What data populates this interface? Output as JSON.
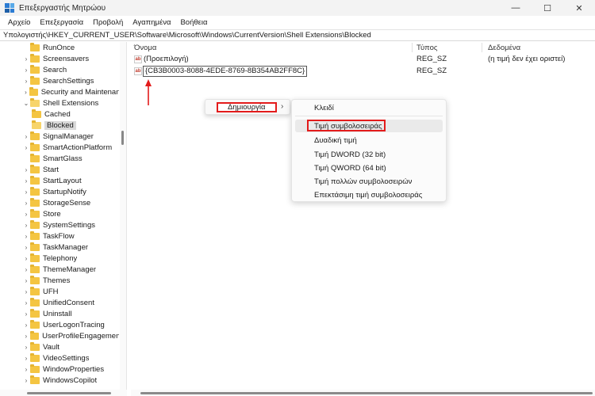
{
  "window": {
    "title": "Επεξεργαστής Μητρώου",
    "minimize": "—",
    "maximize": "☐",
    "close": "✕"
  },
  "menu": [
    "Αρχείο",
    "Επεξεργασία",
    "Προβολή",
    "Αγαπημένα",
    "Βοήθεια"
  ],
  "address": "Υπολογιστής\\HKEY_CURRENT_USER\\Software\\Microsoft\\Windows\\CurrentVersion\\Shell Extensions\\Blocked",
  "tree": [
    {
      "label": "RunOnce",
      "chev": "",
      "indent": 1
    },
    {
      "label": "Screensavers",
      "chev": "›",
      "indent": 1
    },
    {
      "label": "Search",
      "chev": "›",
      "indent": 1
    },
    {
      "label": "SearchSettings",
      "chev": "›",
      "indent": 1
    },
    {
      "label": "Security and Maintenance",
      "chev": "›",
      "indent": 1
    },
    {
      "label": "Shell Extensions",
      "chev": "⌄",
      "indent": 1
    },
    {
      "label": "Cached",
      "chev": "",
      "indent": 2
    },
    {
      "label": "Blocked",
      "chev": "",
      "indent": 2,
      "selected": true
    },
    {
      "label": "SignalManager",
      "chev": "›",
      "indent": 1
    },
    {
      "label": "SmartActionPlatform",
      "chev": "›",
      "indent": 1
    },
    {
      "label": "SmartGlass",
      "chev": "",
      "indent": 1
    },
    {
      "label": "Start",
      "chev": "›",
      "indent": 1
    },
    {
      "label": "StartLayout",
      "chev": "›",
      "indent": 1
    },
    {
      "label": "StartupNotify",
      "chev": "›",
      "indent": 1
    },
    {
      "label": "StorageSense",
      "chev": "›",
      "indent": 1
    },
    {
      "label": "Store",
      "chev": "›",
      "indent": 1
    },
    {
      "label": "SystemSettings",
      "chev": "›",
      "indent": 1
    },
    {
      "label": "TaskFlow",
      "chev": "›",
      "indent": 1
    },
    {
      "label": "TaskManager",
      "chev": "›",
      "indent": 1
    },
    {
      "label": "Telephony",
      "chev": "›",
      "indent": 1
    },
    {
      "label": "ThemeManager",
      "chev": "›",
      "indent": 1
    },
    {
      "label": "Themes",
      "chev": "›",
      "indent": 1
    },
    {
      "label": "UFH",
      "chev": "›",
      "indent": 1
    },
    {
      "label": "UnifiedConsent",
      "chev": "›",
      "indent": 1
    },
    {
      "label": "Uninstall",
      "chev": "›",
      "indent": 1
    },
    {
      "label": "UserLogonTracing",
      "chev": "›",
      "indent": 1
    },
    {
      "label": "UserProfileEngagement",
      "chev": "›",
      "indent": 1
    },
    {
      "label": "Vault",
      "chev": "›",
      "indent": 1
    },
    {
      "label": "VideoSettings",
      "chev": "›",
      "indent": 1
    },
    {
      "label": "WindowProperties",
      "chev": "›",
      "indent": 1
    },
    {
      "label": "WindowsCopilot",
      "chev": "›",
      "indent": 1
    }
  ],
  "list": {
    "headers": {
      "name": "Όνομα",
      "type": "Τύπος",
      "data": "Δεδομένα"
    },
    "rows": [
      {
        "icon": "ab",
        "name": "(Προεπιλογή)",
        "type": "REG_SZ",
        "data": "(η τιμή δεν έχει οριστεί)",
        "editing": false
      },
      {
        "icon": "ab",
        "name": "{CB3B0003-8088-4EDE-8769-8B354AB2FF8C}",
        "type": "REG_SZ",
        "data": "",
        "editing": true
      }
    ]
  },
  "context_menu": {
    "new_label": "Δημιουργία",
    "chevron": "›",
    "submenu": [
      "Κλειδί",
      "Τιμή συμβολοσειράς",
      "Δυαδική τιμή",
      "Τιμή DWORD (32 bit)",
      "Τιμή QWORD (64 bit)",
      "Τιμή πολλών συμβολοσειρών",
      "Επεκτάσιμη τιμή συμβολοσειράς"
    ]
  },
  "colors": {
    "highlight": "#e31b1b",
    "folder": "#f4c542",
    "app_icon": "#2b7cd3"
  }
}
